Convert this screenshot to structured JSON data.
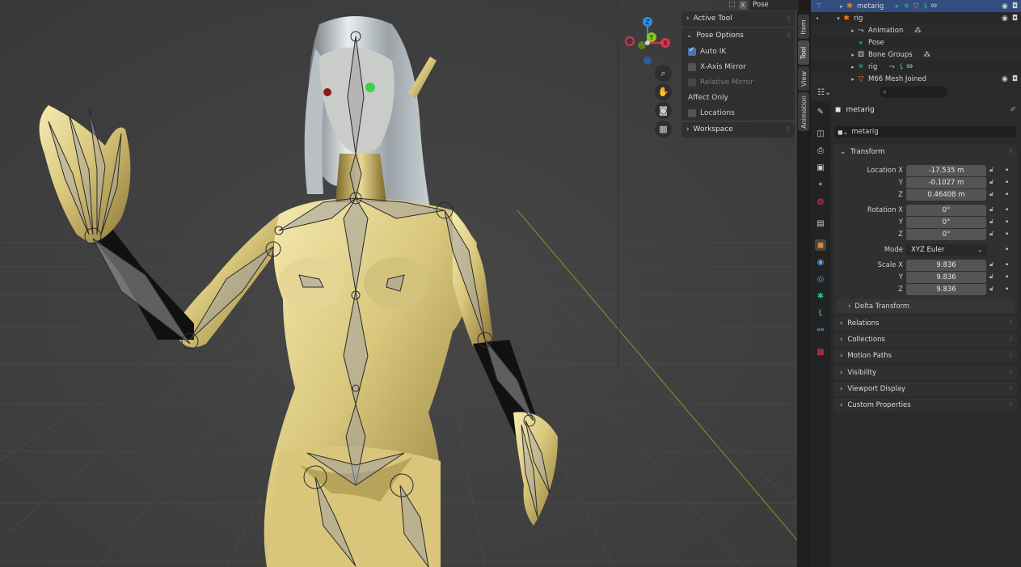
{
  "header": {
    "pose_options_label": "Pose Options",
    "x_label": "X"
  },
  "npanel": {
    "active_tool": "Active Tool",
    "pose_options": "Pose Options",
    "auto_ik": "Auto IK",
    "x_axis_mirror": "X-Axis Mirror",
    "relative_mirror": "Relative Mirror",
    "affect_only": "Affect Only",
    "locations": "Locations",
    "workspace": "Workspace"
  },
  "vtabs": [
    "Item",
    "Tool",
    "View",
    "Animation"
  ],
  "gizmo": {
    "z": "Z",
    "y": "Y",
    "x": "X"
  },
  "outliner": {
    "rows": [
      {
        "label": "metarig",
        "suffix": "99"
      },
      {
        "label": "rig"
      },
      {
        "label": "Animation"
      },
      {
        "label": "Pose"
      },
      {
        "label": "Bone Groups"
      },
      {
        "label": "rig",
        "suffix": "99"
      },
      {
        "label": "M66 Mesh Joined"
      }
    ]
  },
  "properties": {
    "object_name": "metarig",
    "name_field": "metarig",
    "transform_header": "Transform",
    "location_x_label": "Location X",
    "location_x": "-17.535 m",
    "location_y": "-0.1027 m",
    "location_z": "0.46408 m",
    "rotation_x_label": "Rotation X",
    "rotation_x": "0°",
    "rotation_y": "0°",
    "rotation_z": "0°",
    "mode_label": "Mode",
    "mode_value": "XYZ Euler",
    "scale_x_label": "Scale X",
    "scale_x": "9.836",
    "scale_y": "9.836",
    "scale_z": "9.836",
    "y_label": "Y",
    "z_label": "Z",
    "delta_transform": "Delta Transform",
    "relations": "Relations",
    "collections": "Collections",
    "motion_paths": "Motion Paths",
    "visibility": "Visibility",
    "viewport_display": "Viewport Display",
    "custom_properties": "Custom Properties"
  },
  "colors": {
    "accent_blue": "#4772b3",
    "selected_row": "#334d80",
    "axis_x": "#e2334a",
    "axis_y": "#86c51a",
    "axis_z": "#2f8ce8",
    "armature_green": "#2fbf8f",
    "object_orange": "#e8812a"
  }
}
